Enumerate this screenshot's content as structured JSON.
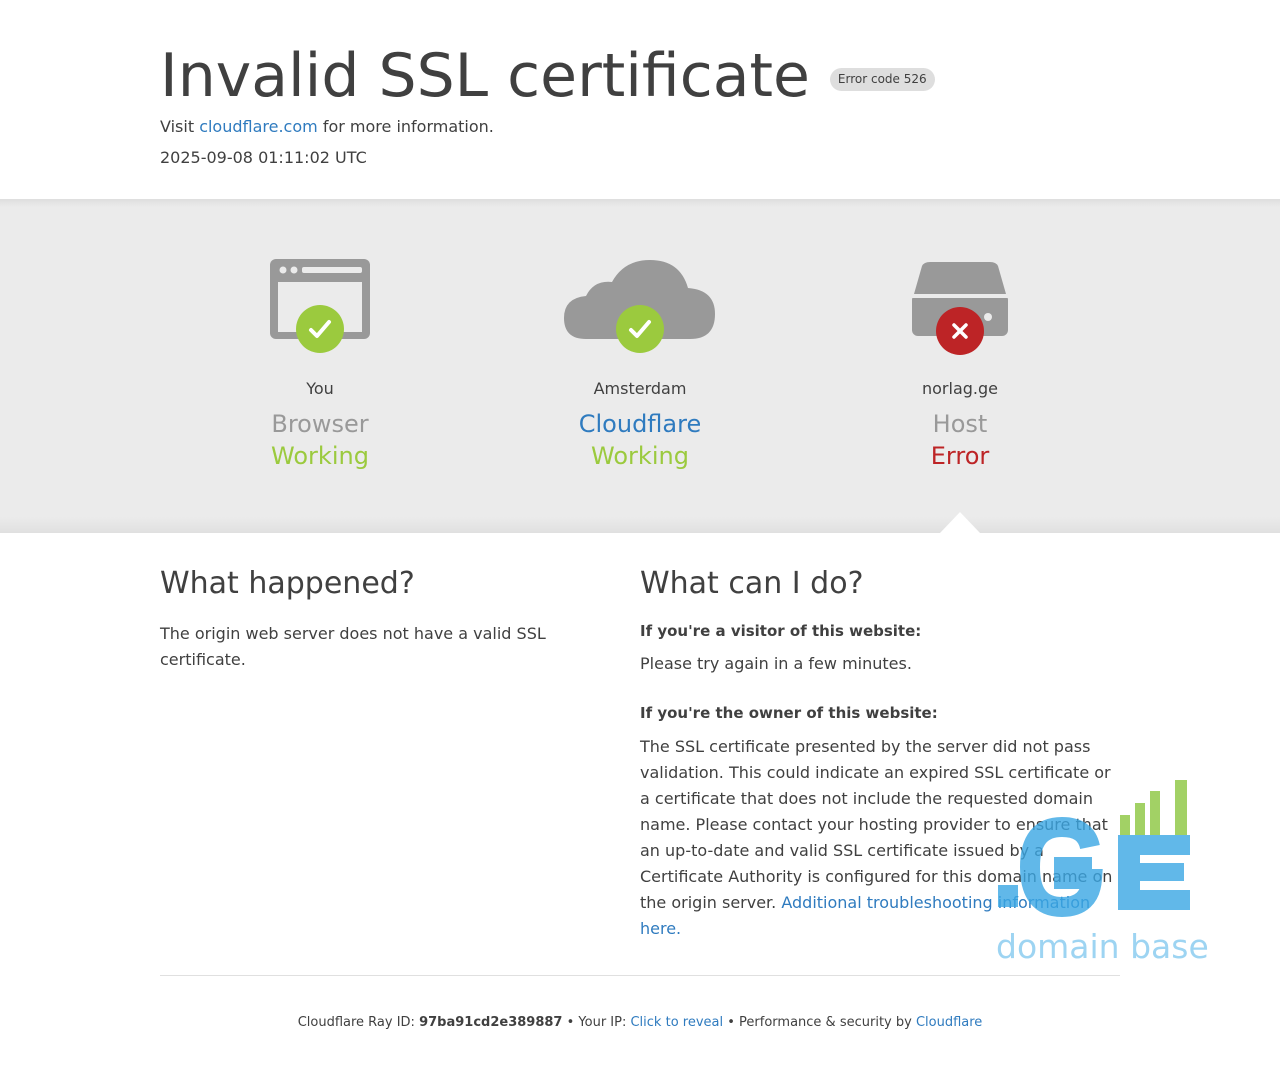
{
  "header": {
    "title": "Invalid SSL certificate",
    "error_badge": "Error code 526",
    "visit_prefix": "Visit ",
    "visit_link": "cloudflare.com",
    "visit_suffix": " for more information.",
    "timestamp": "2025-09-08 01:11:02 UTC"
  },
  "nodes": [
    {
      "location": "You",
      "kind": "Browser",
      "state": "Working",
      "icon": "browser-icon",
      "status_icon": "check-icon"
    },
    {
      "location": "Amsterdam",
      "kind": "Cloudflare",
      "state": "Working",
      "icon": "cloud-icon",
      "status_icon": "check-icon"
    },
    {
      "location": "norlag.ge",
      "kind": "Host",
      "state": "Error",
      "icon": "server-icon",
      "status_icon": "x-icon"
    }
  ],
  "colors": {
    "ok": "#9bca3e",
    "error": "#bd2426",
    "link": "#2f7bbf",
    "icon_gray": "#999999"
  },
  "what_happened": {
    "heading": "What happened?",
    "body": "The origin web server does not have a valid SSL certificate."
  },
  "what_can_i_do": {
    "heading": "What can I do?",
    "visitor_heading": "If you're a visitor of this website:",
    "visitor_body": "Please try again in a few minutes.",
    "owner_heading": "If you're the owner of this website:",
    "owner_body": "The SSL certificate presented by the server did not pass validation. This could indicate an expired SSL certificate or a certificate that does not include the requested domain name. Please contact your hosting provider to ensure that an up-to-date and valid SSL certificate issued by a Certificate Authority is configured for this domain name on the origin server. ",
    "owner_link": "Additional troubleshooting information here."
  },
  "footer": {
    "ray_label": "Cloudflare Ray ID: ",
    "ray_id": "97ba91cd2e389887",
    "sep1": " • ",
    "ip_label": "Your IP: ",
    "ip_link": "Click to reveal",
    "sep2": " • ",
    "perf_label": "Performance & security by ",
    "perf_link": "Cloudflare"
  },
  "watermark": {
    "logo_text": ".GE",
    "tagline": "domain base"
  }
}
